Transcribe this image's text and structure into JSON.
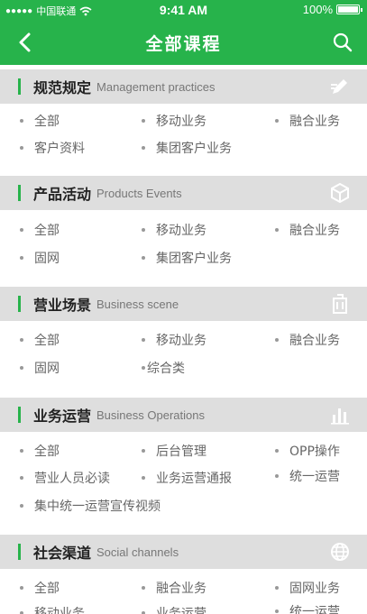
{
  "status_bar": {
    "signal": "●●●●●",
    "carrier": "中国联通",
    "time": "9:41 AM",
    "battery": "100%"
  },
  "header": {
    "title": "全部课程"
  },
  "sections": [
    {
      "title": "规范规定",
      "subtitle": "Management practices",
      "icon": "pencil-icon",
      "items": [
        "全部",
        "移动业务",
        "融合业务",
        "客户资料",
        "集团客户业务"
      ]
    },
    {
      "title": "产品活动",
      "subtitle": "Products Events",
      "icon": "cube-icon",
      "items": [
        "全部",
        "移动业务",
        "融合业务",
        "固网",
        "集团客户业务"
      ]
    },
    {
      "title": "营业场景",
      "subtitle": "Business scene",
      "icon": "building-icon",
      "items": [
        "全部",
        "移动业务",
        "融合业务",
        "固网",
        "综合类"
      ]
    },
    {
      "title": "业务运营",
      "subtitle": "Business Operations",
      "icon": "bar-chart-icon",
      "items": [
        "全部",
        "后台管理",
        "OPP操作",
        "营业人员必读",
        "业务运营通报",
        "统一运营",
        "集中统一运营宣传视频"
      ]
    },
    {
      "title": "社会渠道",
      "subtitle": "Social channels",
      "icon": "globe-icon",
      "items": [
        "全部",
        "融合业务",
        "固网业务",
        "移动业务",
        "业务运营",
        "统一运营"
      ]
    }
  ]
}
